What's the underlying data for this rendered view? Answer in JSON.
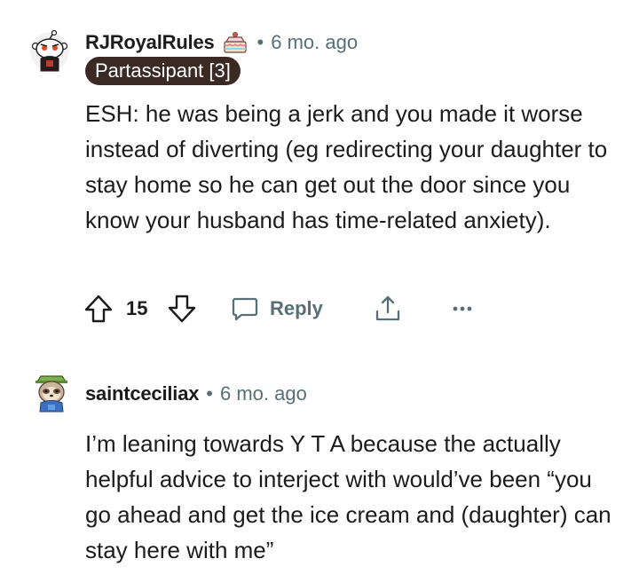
{
  "comments": [
    {
      "username": "RJRoyalRules",
      "separator": "•",
      "time": "6 mo. ago",
      "flair": "Partassipant [3]",
      "body": "ESH: he was being a jerk and you made it worse instead of diverting (eg redirecting your daughter to stay home so he can get out the door since you know your husband has time-related anxiety).",
      "score": "15",
      "reply_label": "Reply",
      "icons": {
        "avatar": "snoo-avatar-icon",
        "cake": "cake-day-icon",
        "upvote": "upvote-arrow-icon",
        "downvote": "downvote-arrow-icon",
        "reply": "speech-bubble-icon",
        "share": "share-icon",
        "more": "more-dots-icon"
      }
    },
    {
      "username": "saintceciliax",
      "separator": "•",
      "time": "6 mo. ago",
      "body": "I’m leaning towards Y T A because the actually helpful advice to interject with would’ve been “you go ahead and get the ice cream and (daughter) can stay here with me”",
      "icons": {
        "avatar": "sloth-avatar-icon"
      }
    }
  ],
  "colors": {
    "text": "#1c1c1c",
    "muted": "#576f76",
    "flair_bg": "#3b2a24",
    "flair_text": "#ffffff"
  }
}
